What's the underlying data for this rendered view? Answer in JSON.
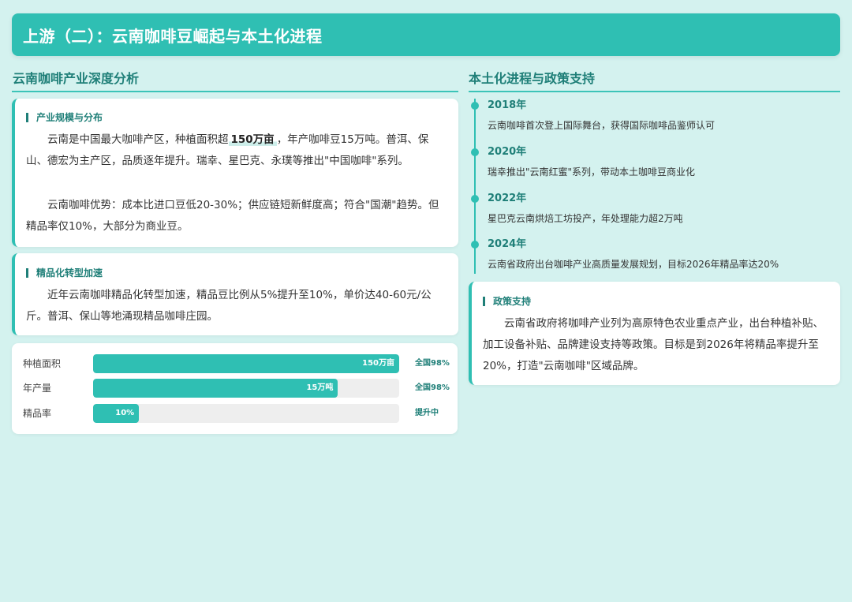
{
  "header": {
    "title": "上游（二）：云南咖啡豆崛起与本土化进程"
  },
  "left": {
    "section_title": "云南咖啡产业深度分析",
    "card1": {
      "title": "产业规模与分布",
      "p1_before": "云南是中国最大咖啡产区，种植面积超",
      "p1_highlight": "150万亩",
      "p1_after": "，年产咖啡豆15万吨。普洱、保山、德宏为主产区，品质逐年提升。瑞幸、星巴克、永璞等推出\"中国咖啡\"系列。",
      "p2": "云南咖啡优势：成本比进口豆低20-30%；供应链短新鲜度高；符合\"国潮\"趋势。但精品率仅10%，大部分为商业豆。"
    },
    "card2": {
      "title": "精品化转型加速",
      "p1": "近年云南咖啡精品化转型加速，精品豆比例从5%提升至10%，单价达40-60元/公斤。普洱、保山等地涌现精品咖啡庄园。"
    },
    "stats": [
      {
        "label": "种植面积",
        "value": "150万亩",
        "note": "全国98%",
        "fill": 1.0
      },
      {
        "label": "年产量",
        "value": "15万吨",
        "note": "全国98%",
        "fill": 0.8
      },
      {
        "label": "精品率",
        "value": "10%",
        "note": "提升中",
        "fill": 0.15
      }
    ]
  },
  "right": {
    "section_title": "本土化进程与政策支持",
    "timeline": [
      {
        "year": "2018年",
        "text": "云南咖啡首次登上国际舞台，获得国际咖啡品鉴师认可"
      },
      {
        "year": "2020年",
        "text": "瑞幸推出\"云南红蜜\"系列，带动本土咖啡豆商业化"
      },
      {
        "year": "2022年",
        "text": "星巴克云南烘焙工坊投产，年处理能力超2万吨"
      },
      {
        "year": "2024年",
        "text": "云南省政府出台咖啡产业高质量发展规划，目标2026年精品率达20%"
      }
    ],
    "policy": {
      "title": "政策支持",
      "p1": "云南省政府将咖啡产业列为高原特色农业重点产业，出台种植补贴、加工设备补贴、品牌建设支持等政策。目标是到2026年将精品率提升至20%，打造\"云南咖啡\"区域品牌。"
    }
  },
  "colors": {
    "accent": "#2fbfb3",
    "dark_accent": "#1f7f78",
    "background": "#d4f2ef"
  }
}
